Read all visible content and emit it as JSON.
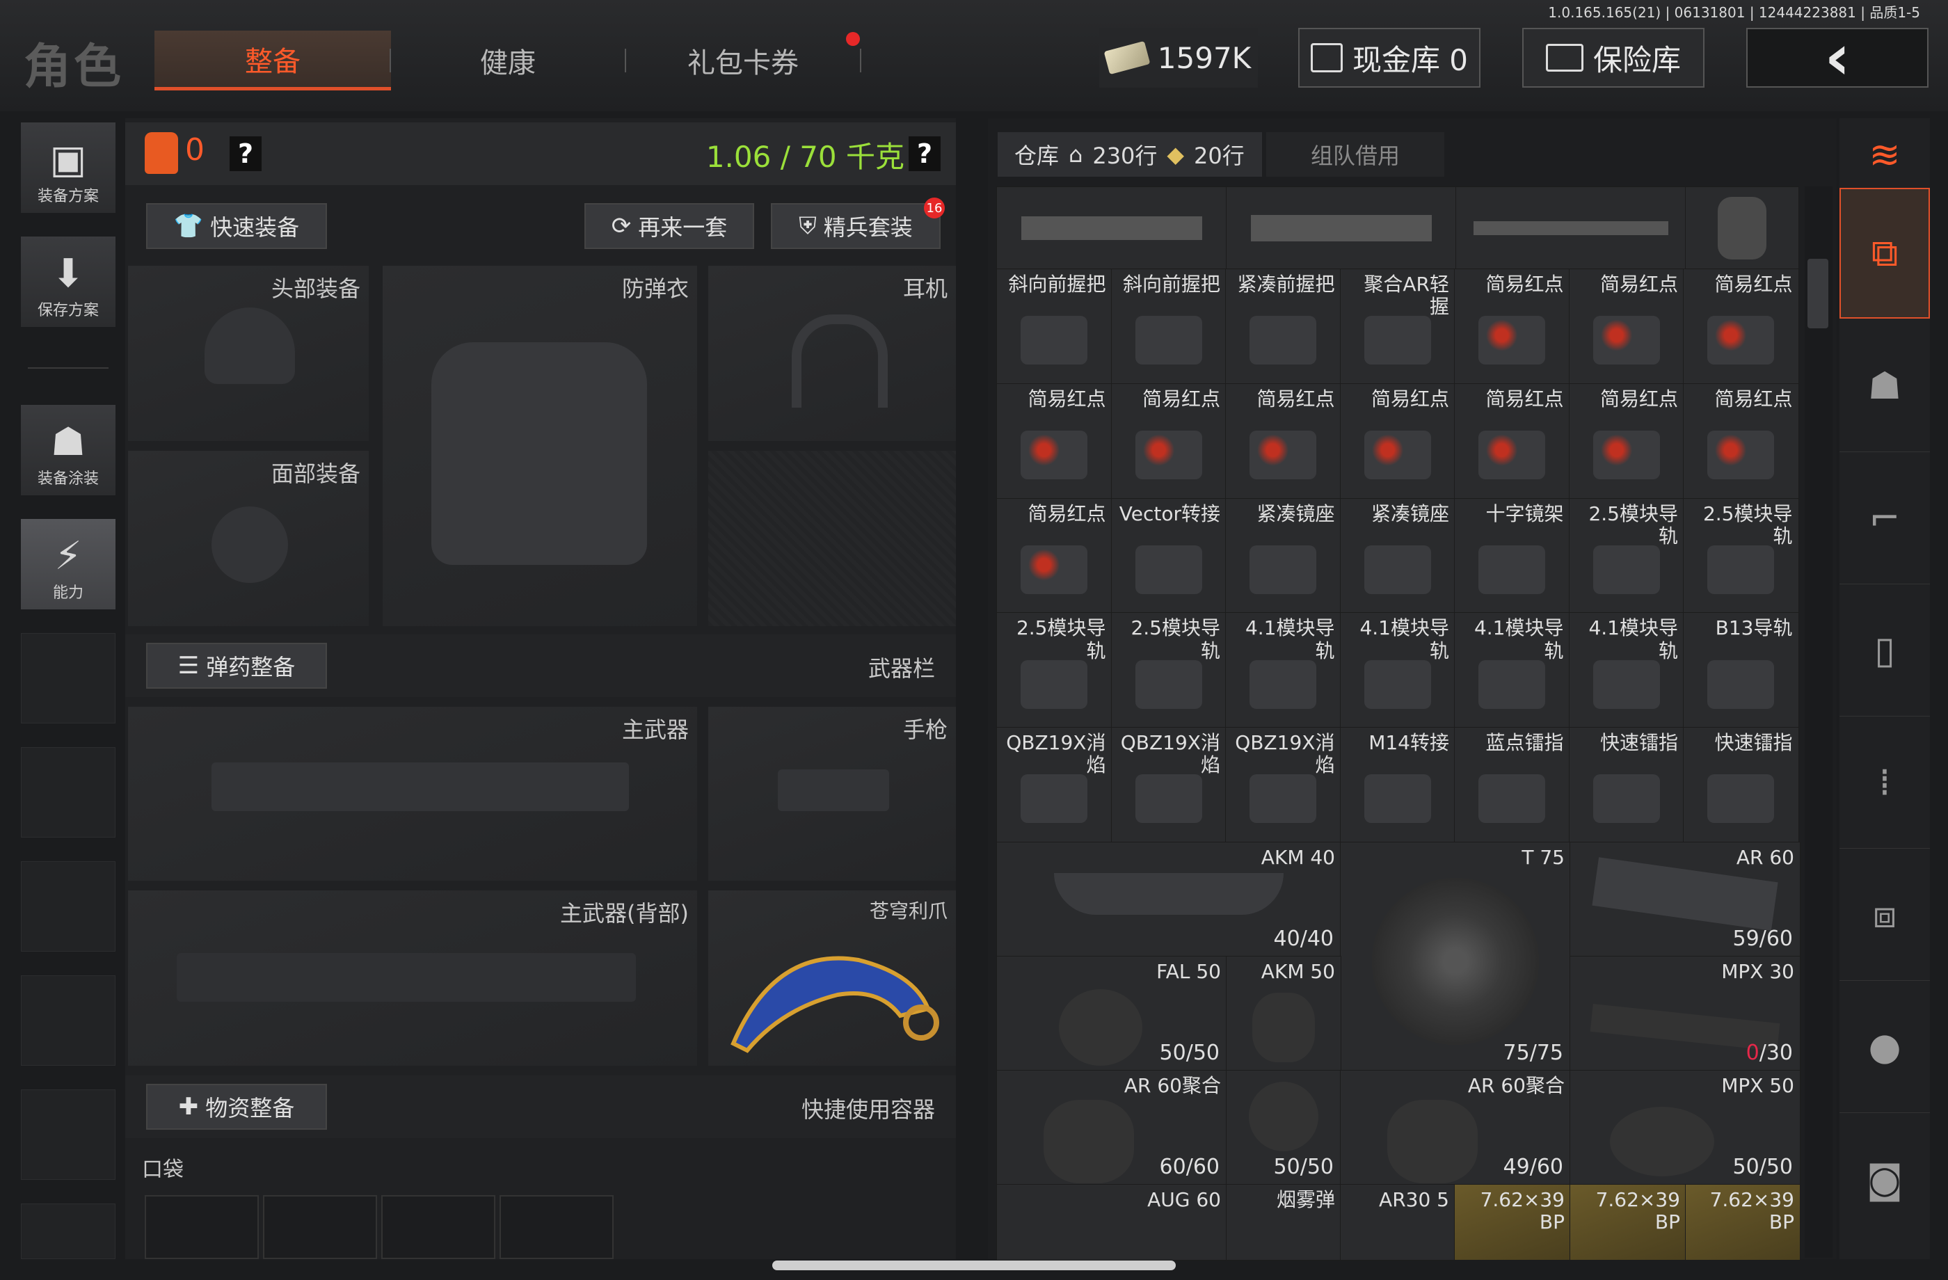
{
  "version": "1.0.165.165(21) | 06131801 | 12444223881 | 品质1-5",
  "header": {
    "role_title": "角色",
    "tabs": [
      "整备",
      "健康",
      "礼包卡券"
    ],
    "money": "1597K",
    "cash_vault": "现金库 0",
    "safe": "保险库",
    "back": "‹"
  },
  "left_rail": [
    {
      "label": "装备方案",
      "icon": "vest-icon"
    },
    {
      "label": "保存方案",
      "icon": "download-icon"
    },
    {
      "label": "装备涂装",
      "icon": "helmet-paint-icon"
    },
    {
      "label": "能力",
      "icon": "ability-icon"
    }
  ],
  "loadout": {
    "backpack_count": "0",
    "help": "?",
    "weight": "1.06 / 70 千克",
    "quick_equip": "快速装备",
    "again": "再来一套",
    "elite": "精兵套装",
    "elite_badge": "16",
    "slots": {
      "head": "头部装备",
      "armor": "防弹衣",
      "headset": "耳机",
      "face": "面部装备"
    },
    "ammo_section": "弹药整备",
    "weapon_bar": "武器栏",
    "primary": "主武器",
    "pistol": "手枪",
    "primary_back": "主武器(背部)",
    "melee": "苍穹利爪",
    "supply_section": "物资整备",
    "quick_container": "快捷使用容器",
    "pocket": "口袋"
  },
  "warehouse": {
    "tab_storage": "仓库",
    "rows_home": "230行",
    "rows_tag": "20行",
    "team_borrow": "组队借用",
    "cells_row1": [
      "斜向前握把",
      "斜向前握把",
      "紧凑前握把",
      "聚合AR轻握",
      "简易红点",
      "简易红点",
      "简易红点"
    ],
    "cells_row2": [
      "简易红点",
      "简易红点",
      "简易红点",
      "简易红点",
      "简易红点",
      "简易红点",
      "简易红点"
    ],
    "cells_row3": [
      "简易红点",
      "Vector转接",
      "紧凑镜座",
      "紧凑镜座",
      "十字镜架",
      "2.5模块导轨",
      "2.5模块导轨"
    ],
    "cells_row4": [
      "2.5模块导轨",
      "2.5模块导轨",
      "4.1模块导轨",
      "4.1模块导轨",
      "4.1模块导轨",
      "4.1模块导轨",
      "B13导轨"
    ],
    "cells_row5": [
      "QBZ19X消焰",
      "QBZ19X消焰",
      "QBZ19X消焰",
      "M14转接",
      "蓝点镭指",
      "快速镭指",
      "快速镭指"
    ],
    "mags": [
      {
        "name": "AKM 40",
        "count": "40/40"
      },
      {
        "name": "T 75",
        "count": "75/75"
      },
      {
        "name": "AR 60",
        "count": "59/60"
      },
      {
        "name": "FAL 50",
        "count": "50/50"
      },
      {
        "name": "AKM 50",
        "count": ""
      },
      {
        "name": "MPX 30",
        "count_red": "0",
        "count": "/30"
      },
      {
        "name": "AR 60聚合",
        "count": "60/60"
      },
      {
        "name": "",
        "count": "50/50"
      },
      {
        "name": "AR 60聚合",
        "count": "49/60"
      },
      {
        "name": "MPX 50",
        "count": "50/50"
      }
    ],
    "bottom_row": [
      "AUG 60",
      "烟雾弹",
      "AR30 5",
      "7.62×39 BP",
      "7.62×39 BP",
      "7.62×39 BP"
    ]
  },
  "colors": {
    "accent": "#ff5a2a",
    "weight_green": "#9be03a",
    "gold_cell": "#6a5a2a"
  }
}
